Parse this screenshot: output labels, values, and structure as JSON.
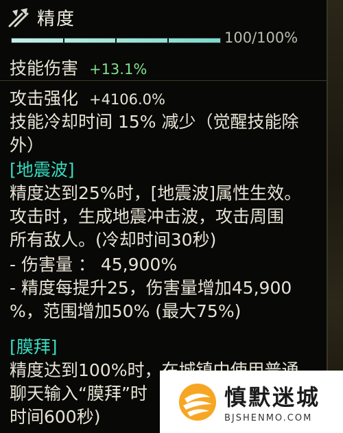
{
  "tooltip": {
    "title": "精度",
    "progress": {
      "label": "100/100%",
      "fraction": 1.0
    },
    "skill_damage": {
      "label": "技能伤害",
      "value": "+13.1%"
    },
    "attack_boost": {
      "label": "攻击强化",
      "value": "+4106.0%"
    },
    "cooldown": {
      "text": "技能冷却时间 15% 减少（觉醒技能除",
      "cont": "外）"
    },
    "section1": {
      "name": "[地震波]",
      "lines": [
        "精度达到25%时，[地震波]属性生效。",
        "攻击时，生成地震冲击波，攻击周围",
        "所有敌人。(冷却时间30秒)",
        "- 伤害量 ： 45,900%",
        "- 精度每提升25，伤害量增加45,900",
        "%，范围增加50% (最大75%)"
      ]
    },
    "section2": {
      "name": "[膜拜]",
      "lines": [
        "精度达到100%时，在城镇中使用普通",
        "聊天输入“膜拜”时",
        "时间600秒)"
      ]
    }
  },
  "watermark": {
    "name": "慎默迷城",
    "domain": "BJSHENMO.COM"
  },
  "colors": {
    "value_green": "#7fe08a",
    "section_teal": "#36dcc2",
    "bar_fill": "#9fe6dc"
  },
  "icons": {
    "header": "crossed-weapons-icon",
    "watermark": "flame-logo-icon"
  }
}
